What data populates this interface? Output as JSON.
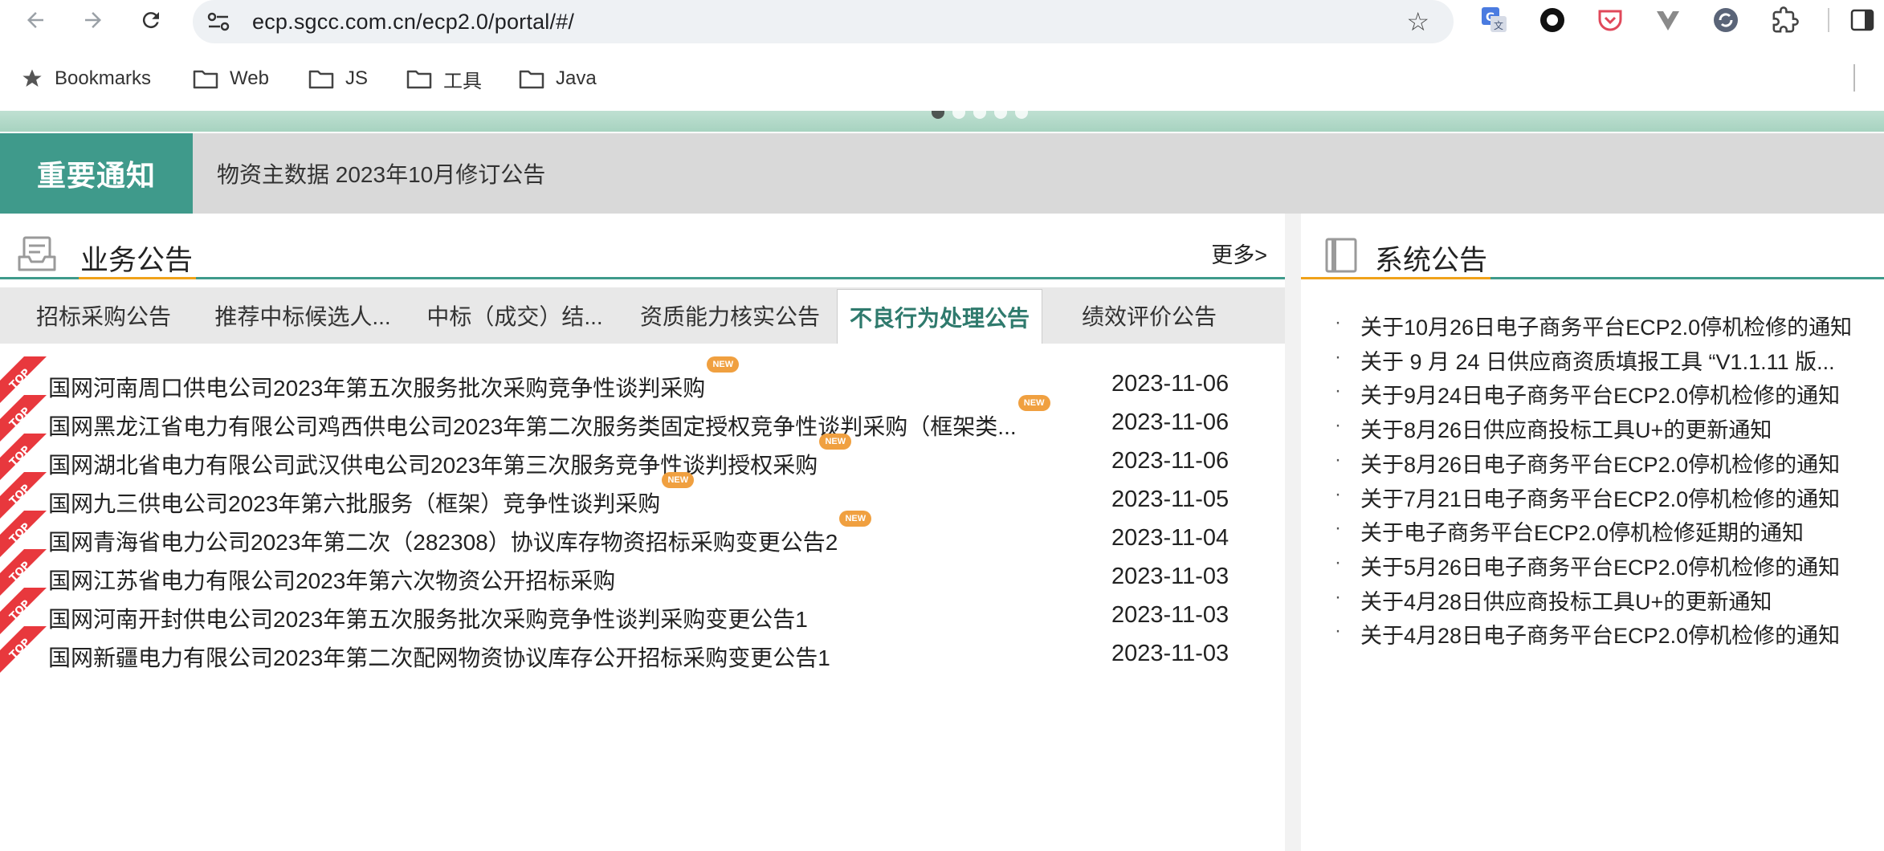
{
  "browser": {
    "url": "ecp.sgcc.com.cn/ecp2.0/portal/#/",
    "bookmarks": [
      {
        "label": "Bookmarks",
        "icon": "star-icon"
      },
      {
        "label": "Web",
        "icon": "folder-icon"
      },
      {
        "label": "JS",
        "icon": "folder-icon"
      },
      {
        "label": "工具",
        "icon": "folder-icon"
      },
      {
        "label": "Java",
        "icon": "folder-icon"
      }
    ]
  },
  "notice": {
    "tag": "重要通知",
    "text": "物资主数据 2023年10月修订公告"
  },
  "business": {
    "title": "业务公告",
    "more": "更多>",
    "tabs": [
      {
        "label": "招标采购公告"
      },
      {
        "label": "推荐中标候选人..."
      },
      {
        "label": "中标（成交）结..."
      },
      {
        "label": "资质能力核实公告"
      },
      {
        "label": "不良行为处理公告",
        "active": true
      },
      {
        "label": "绩效评价公告"
      }
    ],
    "top_badge": "TOP",
    "new_badge": "NEW",
    "items": [
      {
        "title": "国网河南周口供电公司2023年第五次服务批次采购竞争性谈判采购",
        "date": "2023-11-06",
        "is_new": true
      },
      {
        "title": "国网黑龙江省电力有限公司鸡西供电公司2023年第二次服务类固定授权竞争性谈判采购（框架类...",
        "date": "2023-11-06",
        "is_new": true
      },
      {
        "title": "国网湖北省电力有限公司武汉供电公司2023年第三次服务竞争性谈判授权采购",
        "date": "2023-11-06",
        "is_new": true
      },
      {
        "title": "国网九三供电公司2023年第六批服务（框架）竞争性谈判采购",
        "date": "2023-11-05",
        "is_new": true
      },
      {
        "title": "国网青海省电力公司2023年第二次（282308）协议库存物资招标采购变更公告2",
        "date": "2023-11-04",
        "is_new": true
      },
      {
        "title": "国网江苏省电力有限公司2023年第六次物资公开招标采购",
        "date": "2023-11-03",
        "is_new": false
      },
      {
        "title": "国网河南开封供电公司2023年第五次服务批次采购竞争性谈判采购变更公告1",
        "date": "2023-11-03",
        "is_new": false
      },
      {
        "title": "国网新疆电力有限公司2023年第二次配网物资协议库存公开招标采购变更公告1",
        "date": "2023-11-03",
        "is_new": false
      }
    ]
  },
  "system": {
    "title": "系统公告",
    "bullet": "·",
    "items": [
      {
        "text": "关于10月26日电子商务平台ECP2.0停机检修的通知"
      },
      {
        "text": "关于 9 月 24 日供应商资质填报工具 “V1.1.11 版..."
      },
      {
        "text": "关于9月24日电子商务平台ECP2.0停机检修的通知"
      },
      {
        "text": "关于8月26日供应商投标工具U+的更新通知"
      },
      {
        "text": "关于8月26日电子商务平台ECP2.0停机检修的通知"
      },
      {
        "text": "关于7月21日电子商务平台ECP2.0停机检修的通知"
      },
      {
        "text": "关于电子商务平台ECP2.0停机检修延期的通知"
      },
      {
        "text": "关于5月26日电子商务平台ECP2.0停机检修的通知"
      },
      {
        "text": "关于4月28日供应商投标工具U+的更新通知"
      },
      {
        "text": "关于4月28日电子商务平台ECP2.0停机检修的通知"
      }
    ]
  },
  "colors": {
    "accent_green": "#3f9a8b",
    "accent_orange": "#f0a21a",
    "top_red": "#e8383d",
    "new_orange": "#f0a040"
  }
}
